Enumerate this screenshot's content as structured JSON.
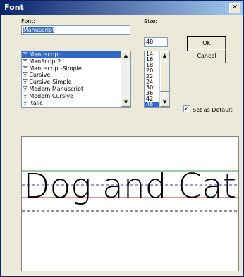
{
  "window": {
    "title": "Font",
    "close_glyph": "✕"
  },
  "font_label": "Font:",
  "font_input_value": "Manuscript",
  "fonts": [
    "Manuscript",
    "ManScript2",
    "Manuscript-Simple",
    "Cursive",
    "Cursive-Simple",
    "Modern Manuscript",
    "Modern Cursive",
    "Italic"
  ],
  "selected_font_index": 0,
  "size_label": "Size:",
  "size_input_value": "48",
  "sizes": [
    "14",
    "16",
    "18",
    "20",
    "22",
    "24",
    "30",
    "36",
    "42",
    "48"
  ],
  "selected_size_index": 9,
  "buttons": {
    "ok": "OK",
    "cancel": "Cancel"
  },
  "set_as_default": {
    "label": "Set as Default",
    "checked": true,
    "check_glyph": "✓"
  },
  "truetype_icon_glyph": "Ŧ",
  "preview_text": "Dog and Cat",
  "colors": {
    "top_line": "#3c9a3c",
    "mid_line": "#3a3acd",
    "base_line": "#cc2222",
    "descender_line": "#222222",
    "selection": "#316ac5"
  }
}
